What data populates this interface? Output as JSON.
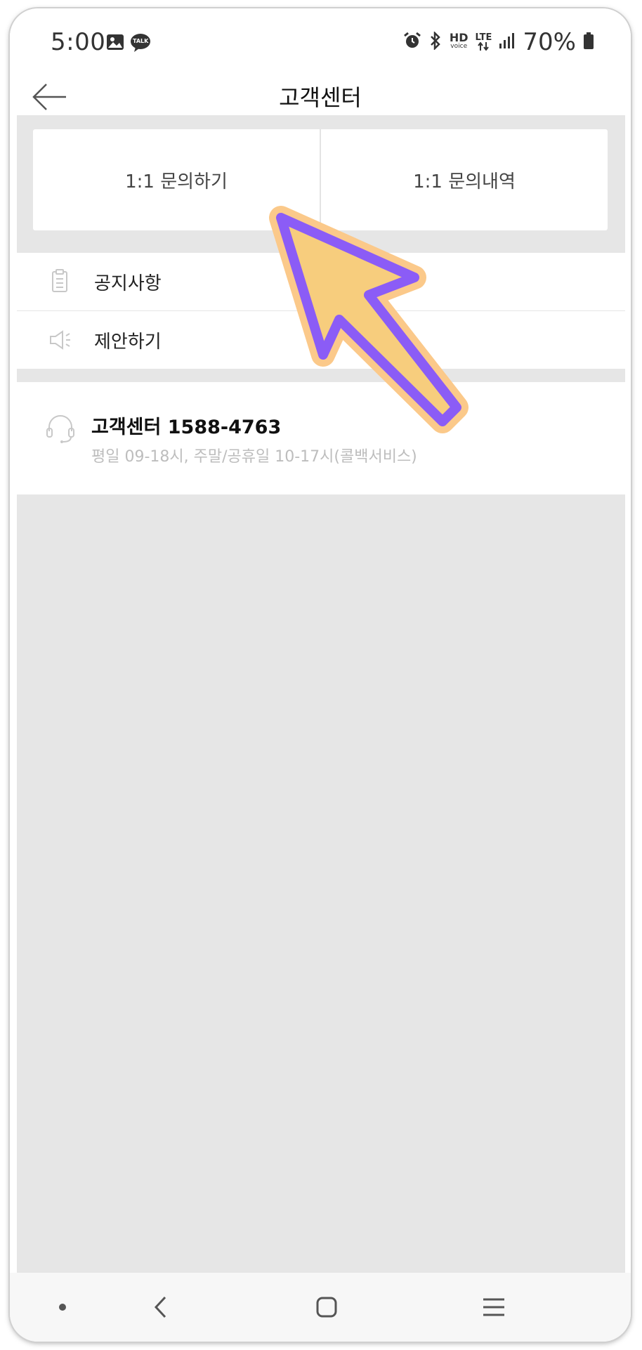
{
  "status_bar": {
    "time": "5:00",
    "battery": "70%",
    "icons": [
      "gallery-icon",
      "kakaotalk-icon",
      "alarm-icon",
      "bluetooth-icon",
      "hd-voice-icon",
      "lte-icon",
      "signal-icon",
      "battery-icon"
    ],
    "talk_badge": "TALK",
    "hd_top": "HD",
    "hd_bottom": "voice",
    "lte": "LTE"
  },
  "header": {
    "title": "고객센터"
  },
  "inquiry": {
    "ask_label": "1:1 문의하기",
    "history_label": "1:1 문의내역"
  },
  "menu": {
    "items": [
      {
        "label": "공지사항",
        "icon": "notice-clipboard-icon"
      },
      {
        "label": "제안하기",
        "icon": "megaphone-icon"
      }
    ]
  },
  "support": {
    "title": "고객센터 1588-4763",
    "hours": "평일 09-18시, 주말/공휴일 10-17시(콜백서비스)"
  },
  "colors": {
    "background_gray": "#e6e6e6",
    "arrow_fill": "#f7cd7d",
    "arrow_stroke": "#8b5cf6",
    "arrow_outline": "#fbc98a"
  }
}
